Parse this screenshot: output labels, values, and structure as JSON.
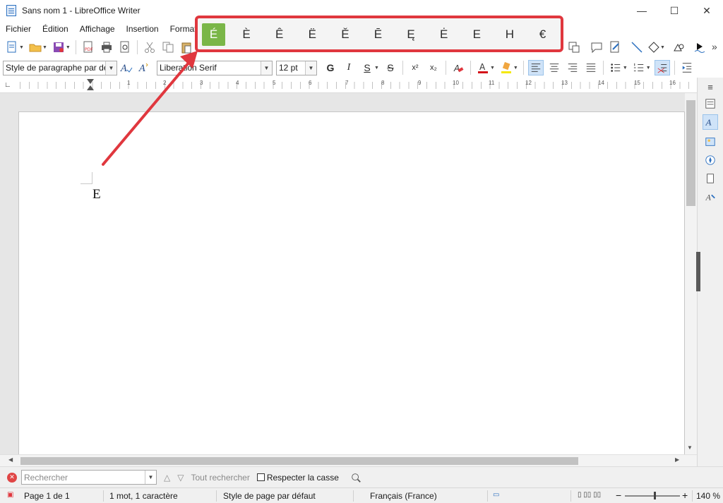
{
  "window": {
    "title": "Sans nom 1 - LibreOffice Writer",
    "minimize_glyph": "—",
    "maximize_glyph": "☐",
    "close_glyph": "✕"
  },
  "menu": {
    "items": [
      "Fichier",
      "Édition",
      "Affichage",
      "Insertion",
      "Format"
    ]
  },
  "toolbar_format": {
    "paragraph_style": "Style de paragraphe par déf",
    "font_name": "Liberation Serif",
    "font_size": "12 pt",
    "bold": "G",
    "italic": "I",
    "underline": "S",
    "strikethrough": "S",
    "superscript": "x²",
    "subscript": "x₂"
  },
  "ruler": {
    "numbers": [
      "1",
      "2",
      "3",
      "4",
      "5",
      "6",
      "7",
      "8",
      "9",
      "10",
      "11",
      "12",
      "13",
      "14",
      "15",
      "16"
    ]
  },
  "document": {
    "text": "E"
  },
  "char_popup": {
    "characters": [
      "É",
      "È",
      "Ê",
      "Ë",
      "Ě",
      "Ē",
      "Ę",
      "Ė",
      "E",
      "H",
      "€"
    ],
    "selected_index": 0
  },
  "findbar": {
    "placeholder": "Rechercher",
    "find_all": "Tout rechercher",
    "match_case": "Respecter la casse"
  },
  "status": {
    "page": "Page 1 de 1",
    "words": "1 mot, 1 caractère",
    "page_style": "Style de page par défaut",
    "language": "Français (France)",
    "zoom": "140 %",
    "zoom_minus": "−",
    "zoom_plus": "+"
  },
  "colors": {
    "highlight_border": "#e0373e",
    "selected_char_bg": "#7ab648",
    "arrow": "#e0373e"
  }
}
